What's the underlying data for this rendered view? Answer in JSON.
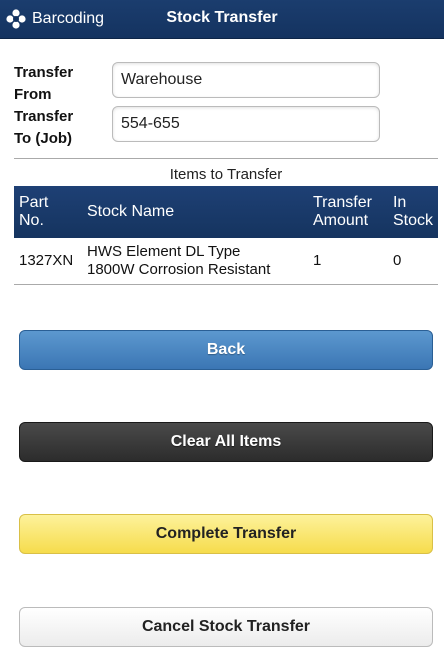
{
  "header": {
    "brand": "Barcoding",
    "brand_icon": "barcoding-logo-icon",
    "title": "Stock Transfer",
    "bar_color": "#143360"
  },
  "form": {
    "from_label_1": "Transfer",
    "from_label_2": "From",
    "from_value": "Warehouse",
    "to_label_1": "Transfer",
    "to_label_2": "To (Job)",
    "to_value": "554-655"
  },
  "items": {
    "caption": "Items to Transfer",
    "columns": {
      "part_1": "Part",
      "part_2": "No.",
      "name": "Stock Name",
      "amount_1": "Transfer",
      "amount_2": "Amount",
      "instock_1": "In",
      "instock_2": "Stock"
    },
    "rows": [
      {
        "part": "1327XN",
        "name_1": "HWS Element DL Type",
        "name_2": "1800W Corrosion Resistant",
        "amount": "1",
        "instock": "0"
      }
    ]
  },
  "buttons": {
    "back": "Back",
    "clear": "Clear All Items",
    "complete": "Complete Transfer",
    "cancel": "Cancel Stock Transfer"
  }
}
